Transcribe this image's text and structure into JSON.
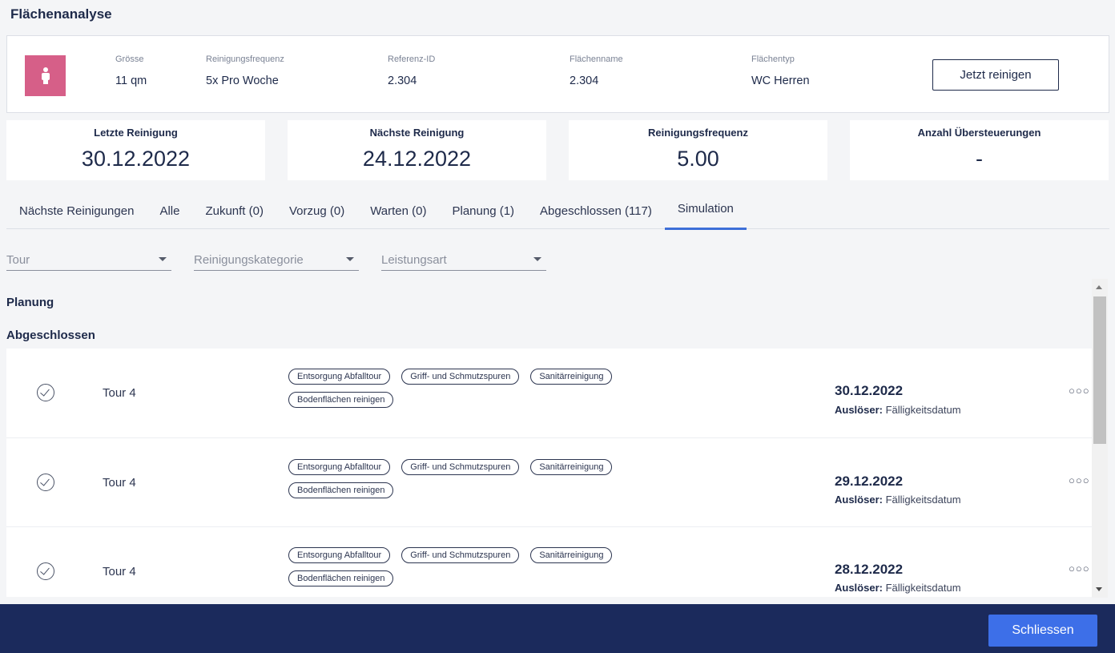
{
  "page": {
    "title": "Flächenanalyse"
  },
  "info": {
    "fields": [
      {
        "label": "Grösse",
        "value": "11 qm"
      },
      {
        "label": "Reinigungsfrequenz",
        "value": "5x Pro Woche"
      },
      {
        "label": "Referenz-ID",
        "value": "2.304"
      },
      {
        "label": "Flächenname",
        "value": "2.304"
      },
      {
        "label": "Flächentyp",
        "value": "WC Herren"
      }
    ],
    "action_label": "Jetzt reinigen",
    "avatar_color": "#d65f88"
  },
  "stats": [
    {
      "label": "Letzte Reinigung",
      "value": "30.12.2022"
    },
    {
      "label": "Nächste Reinigung",
      "value": "24.12.2022"
    },
    {
      "label": "Reinigungsfrequenz",
      "value": "5.00"
    },
    {
      "label": "Anzahl Übersteuerungen",
      "value": "-"
    }
  ],
  "tabs": [
    {
      "label": "Nächste Reinigungen"
    },
    {
      "label": "Alle"
    },
    {
      "label": "Zukunft (0)"
    },
    {
      "label": "Vorzug (0)"
    },
    {
      "label": "Warten (0)"
    },
    {
      "label": "Planung (1)"
    },
    {
      "label": "Abgeschlossen (117)"
    },
    {
      "label": "Simulation",
      "active": true
    }
  ],
  "filters": [
    {
      "label": "Tour"
    },
    {
      "label": "Reinigungskategorie"
    },
    {
      "label": "Leistungsart"
    }
  ],
  "sections": {
    "planning": "Planung",
    "completed": "Abgeschlossen"
  },
  "rows": [
    {
      "tour": "Tour 4",
      "tags": [
        "Entsorgung Abfalltour",
        "Griff- und Schmutzspuren",
        "Sanitärreinigung",
        "Bodenflächen reinigen"
      ],
      "date": "30.12.2022",
      "trigger_label": "Auslöser:",
      "trigger_value": "Fälligkeitsdatum"
    },
    {
      "tour": "Tour 4",
      "tags": [
        "Entsorgung Abfalltour",
        "Griff- und Schmutzspuren",
        "Sanitärreinigung",
        "Bodenflächen reinigen"
      ],
      "date": "29.12.2022",
      "trigger_label": "Auslöser:",
      "trigger_value": "Fälligkeitsdatum"
    },
    {
      "tour": "Tour 4",
      "tags": [
        "Entsorgung Abfalltour",
        "Griff- und Schmutzspuren",
        "Sanitärreinigung",
        "Bodenflächen reinigen"
      ],
      "date": "28.12.2022",
      "trigger_label": "Auslöser:",
      "trigger_value": "Fälligkeitsdatum"
    }
  ],
  "footer": {
    "close_label": "Schliessen",
    "background": "#1b2a5c",
    "button_color": "#3d6fe8"
  }
}
